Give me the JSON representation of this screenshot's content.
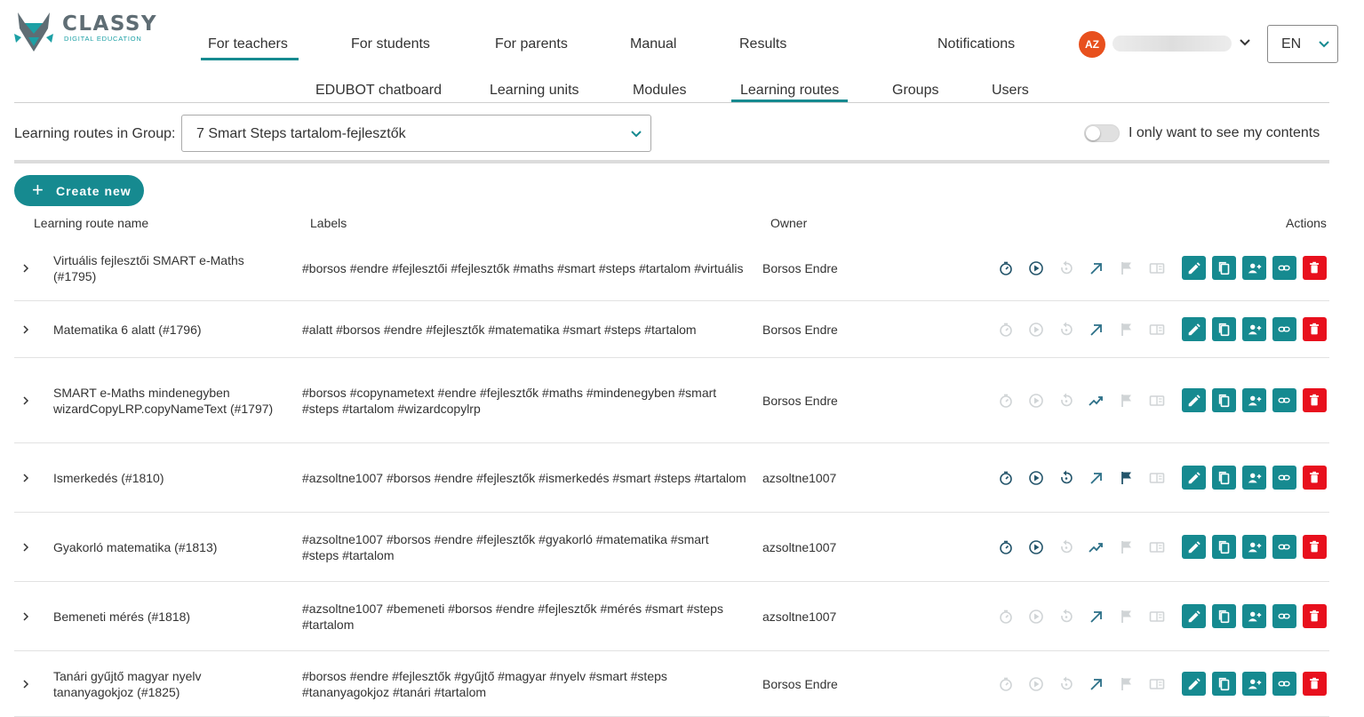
{
  "brand": {
    "name": "CLASSY",
    "tagline": "DIGITAL EDUCATION"
  },
  "top_nav": [
    "For teachers",
    "For students",
    "For parents",
    "Manual",
    "Results",
    "Notifications"
  ],
  "user": {
    "initials": "AZ"
  },
  "language": "EN",
  "sub_nav": [
    "EDUBOT chatboard",
    "Learning units",
    "Modules",
    "Learning routes",
    "Groups",
    "Users"
  ],
  "filter": {
    "group_label": "Learning routes in Group:",
    "group_value": "7 Smart Steps tartalom-fejlesztők",
    "toggle_label": "I only want to see my contents",
    "toggle_on": false
  },
  "create_button": "Create new",
  "table": {
    "headers": [
      "Learning route name",
      "Labels",
      "Owner",
      "Actions"
    ],
    "rows": [
      {
        "name": "Virtuális fejlesztői SMART e-Maths (#1795)",
        "labels": "#borsos #endre #fejlesztői #fejlesztők #maths #smart #steps #tartalom #virtuális",
        "owner": "Borsos Endre",
        "status": [
          true,
          true,
          false,
          true,
          false,
          false
        ],
        "trend": "arrow"
      },
      {
        "name": "Matematika 6 alatt (#1796)",
        "labels": "#alatt #borsos #endre #fejlesztők #matematika #smart #steps #tartalom",
        "owner": "Borsos Endre",
        "status": [
          false,
          false,
          false,
          true,
          false,
          false
        ],
        "trend": "arrow"
      },
      {
        "name": "SMART e-Maths mindenegyben wizardCopyLRP.copyNameText (#1797)",
        "labels": "#borsos #copynametext #endre #fejlesztők #maths #mindenegyben #smart #steps #tartalom #wizardcopylrp",
        "owner": "Borsos Endre",
        "status": [
          false,
          false,
          false,
          true,
          false,
          false
        ],
        "trend": "trending"
      },
      {
        "name": "Ismerkedés (#1810)",
        "labels": "#azsoltne1007 #borsos #endre #fejlesztők #ismerkedés #smart #steps #tartalom",
        "owner": "azsoltne1007",
        "status": [
          true,
          true,
          true,
          true,
          true,
          false
        ],
        "trend": "arrow"
      },
      {
        "name": "Gyakorló matematika (#1813)",
        "labels": "#azsoltne1007 #borsos #endre #fejlesztők #gyakorló #matematika #smart #steps #tartalom",
        "owner": "azsoltne1007",
        "status": [
          true,
          true,
          false,
          true,
          false,
          false
        ],
        "trend": "trending"
      },
      {
        "name": "Bemeneti mérés (#1818)",
        "labels": "#azsoltne1007 #bemeneti #borsos #endre #fejlesztők #mérés #smart #steps #tartalom",
        "owner": "azsoltne1007",
        "status": [
          false,
          false,
          false,
          true,
          false,
          false
        ],
        "trend": "arrow"
      },
      {
        "name": "Tanári gyűjtő magyar nyelv tananyagokjoz (#1825)",
        "labels": "#borsos #endre #fejlesztők #gyűjtő #magyar #nyelv #smart #steps #tananyagokjoz #tanári #tartalom",
        "owner": "Borsos Endre",
        "status": [
          false,
          false,
          false,
          true,
          false,
          false
        ],
        "trend": "arrow"
      }
    ]
  },
  "colors": {
    "accent": "#168a90",
    "danger": "#e8101d",
    "avatar": "#e8501d",
    "icon_active": "#24556b",
    "icon_inactive": "#d0d4d6"
  }
}
